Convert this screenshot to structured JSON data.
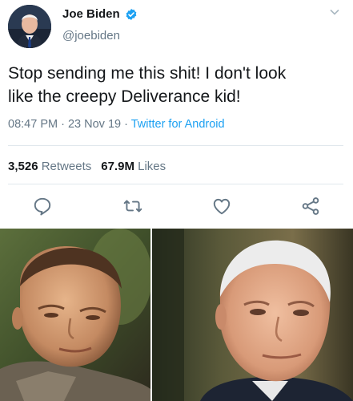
{
  "tweet": {
    "display_name": "Joe Biden",
    "handle": "@joebiden",
    "verified_icon": "verified-badge-icon",
    "text_line1": "Stop sending me this shit! I don't look",
    "text_line2": "like the creepy Deliverance kid!",
    "time": "08:47 PM",
    "separator1": " · ",
    "date": "23 Nov 19",
    "separator2": " · ",
    "source": "Twitter for Android",
    "retweets_count": "3,526",
    "retweets_label": "Retweets",
    "likes_count": "67.9M",
    "likes_label": "Likes"
  },
  "actions": [
    {
      "icon": "reply-icon"
    },
    {
      "icon": "retweet-icon"
    },
    {
      "icon": "like-icon"
    },
    {
      "icon": "share-icon"
    }
  ],
  "colors": {
    "link": "#1da1f2",
    "secondary_text": "#657786",
    "verified": "#1da1f2"
  }
}
